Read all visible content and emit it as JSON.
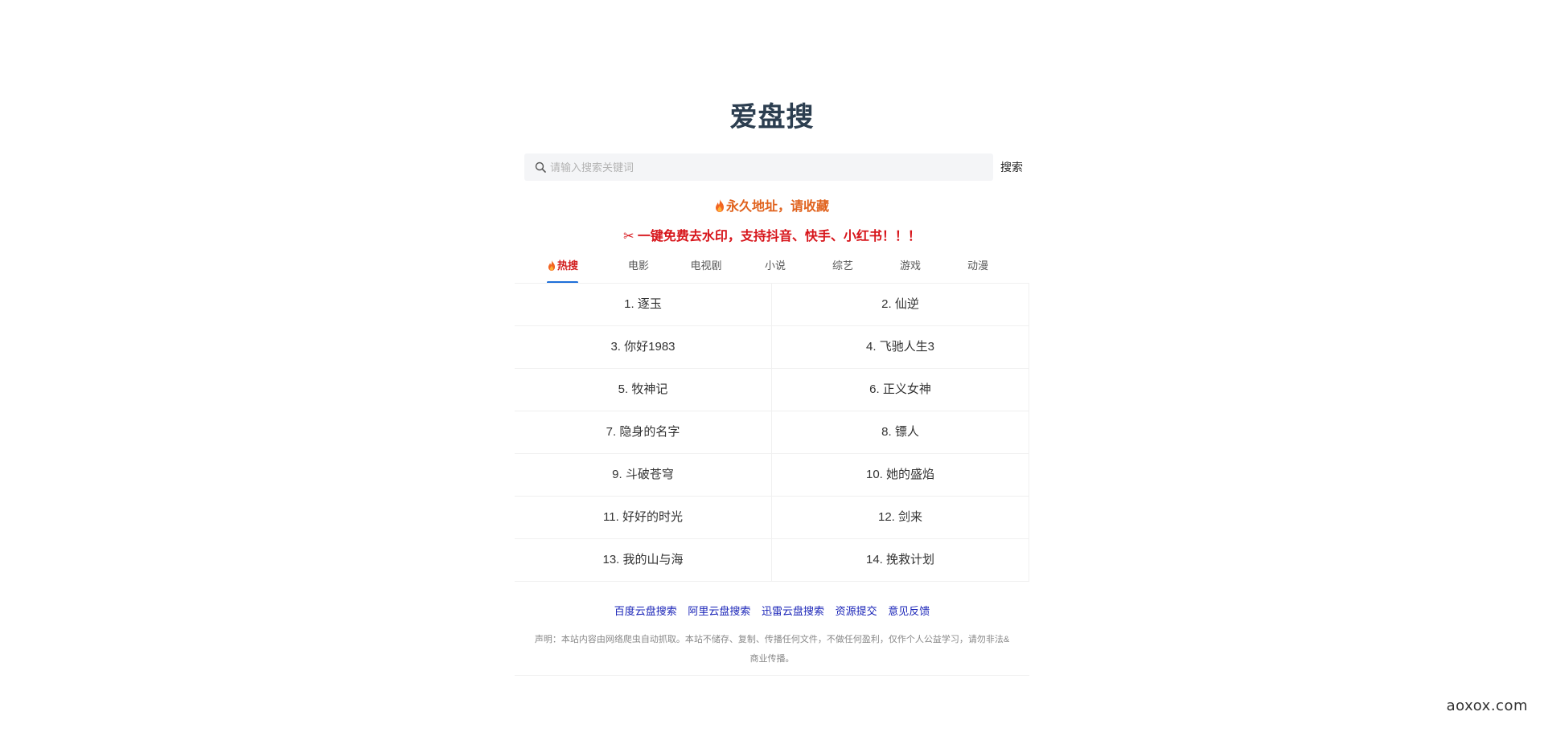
{
  "site": {
    "title": "爱盘搜"
  },
  "search": {
    "placeholder": "请输入搜索关键词",
    "value": "",
    "button_label": "搜索"
  },
  "notices": {
    "permanent_address": "永久地址，请收藏",
    "watermark_tool": "✂ 一键免费去水印，支持抖音、快手、小红书！！！"
  },
  "tabs": [
    {
      "label": "热搜",
      "active": true,
      "icon": "flame-icon"
    },
    {
      "label": "电影",
      "active": false
    },
    {
      "label": "电视剧",
      "active": false
    },
    {
      "label": "小说",
      "active": false
    },
    {
      "label": "综艺",
      "active": false
    },
    {
      "label": "游戏",
      "active": false
    },
    {
      "label": "动漫",
      "active": false
    }
  ],
  "hot_list": [
    "1. 逐玉",
    "2. 仙逆",
    "3. 你好1983",
    "4. 飞驰人生3",
    "5. 牧神记",
    "6. 正义女神",
    "7. 隐身的名字",
    "8. 镖人",
    "9. 斗破苍穹",
    "10. 她的盛焰",
    "11. 好好的时光",
    "12. 剑来",
    "13. 我的山与海",
    "14. 挽救计划"
  ],
  "footer": {
    "links": [
      "百度云盘搜索",
      "阿里云盘搜索",
      "迅雷云盘搜索",
      "资源提交",
      "意见反馈"
    ],
    "disclaimer": "声明：本站内容由网络爬虫自动抓取。本站不储存、复制、传播任何文件，不做任何盈利，仅作个人公益学习，请勿非法&商业传播。"
  },
  "watermark": "aoxox.com",
  "colors": {
    "title": "#2c3e50",
    "notice_orange": "#e0621d",
    "notice_red": "#d7141a",
    "tab_active": "#d21f1f",
    "tab_underline": "#1e6fd9",
    "link_blue": "#1a24b8"
  }
}
